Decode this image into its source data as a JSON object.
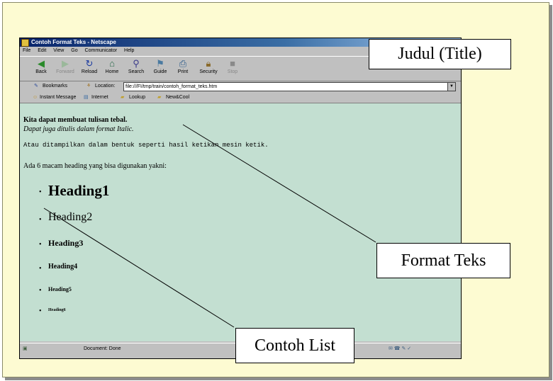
{
  "browser": {
    "title": "Contoh Format Teks - Netscape",
    "menu": [
      "File",
      "Edit",
      "View",
      "Go",
      "Communicator",
      "Help"
    ],
    "toolbar": [
      {
        "label": "Back",
        "icon": "back-arrow-icon",
        "disabled": false
      },
      {
        "label": "Forward",
        "icon": "forward-arrow-icon",
        "disabled": true
      },
      {
        "label": "Reload",
        "icon": "reload-icon",
        "disabled": false
      },
      {
        "label": "Home",
        "icon": "home-icon",
        "disabled": false
      },
      {
        "label": "Search",
        "icon": "search-icon",
        "disabled": false
      },
      {
        "label": "Guide",
        "icon": "guide-icon",
        "disabled": false
      },
      {
        "label": "Print",
        "icon": "print-icon",
        "disabled": false
      },
      {
        "label": "Security",
        "icon": "security-lock-icon",
        "disabled": false
      },
      {
        "label": "Stop",
        "icon": "stop-icon",
        "disabled": true
      }
    ],
    "bookmarks_label": "Bookmarks",
    "location_label": "Location:",
    "location_url": "file:///FI/tmp/train/contoh_format_teks.htm",
    "personal_toolbar": [
      "Instant Message",
      "Internet",
      "Lookup",
      "New&Cool"
    ],
    "status_text": "Document: Done"
  },
  "page": {
    "bold_text": "Kita dapat membuat tulisan tebal.",
    "italic_text": "Dapat juga ditulis dalam format Italic.",
    "mono_text": "Atau ditampilkan dalam bentuk seperti hasil ketikan mesin ketik.",
    "intro_text": "Ada 6 macam heading yang bisa digunakan yakni:",
    "headings": [
      "Heading1",
      "Heading2",
      "Heading3",
      "Heading4",
      "Heading5",
      "Heading6"
    ]
  },
  "annotations": {
    "title_label": "Judul (Title)",
    "format_label": "Format Teks",
    "list_label": "Contoh List"
  },
  "colors": {
    "slide_background": "#fdfbd2",
    "page_background": "#c3dfd1",
    "titlebar": "#08246b",
    "window_chrome": "#c0c0c0"
  }
}
